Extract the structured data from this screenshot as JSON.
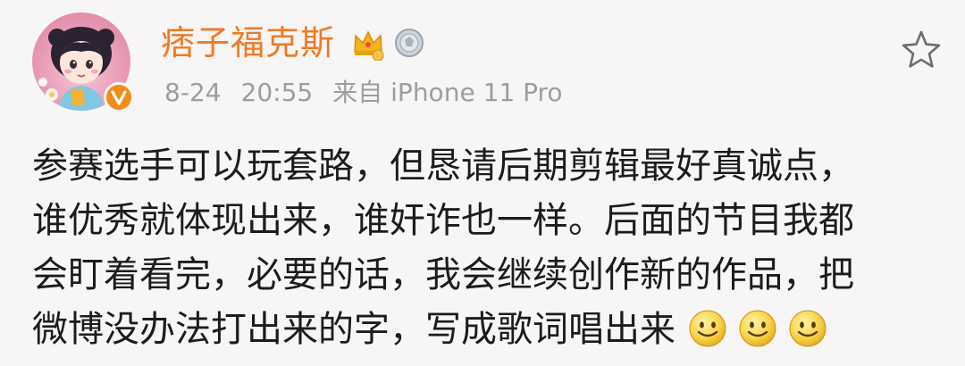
{
  "post": {
    "username": "痞子福克斯",
    "meta": {
      "date": "8-24",
      "time": "20:55",
      "source": "来自 iPhone 11 Pro"
    },
    "text_lines": [
      "参赛选手可以玩套路，但恳请后期剪辑最好真诚点，",
      "谁优秀就体现出来，谁奸诈也一样。后面的节目我都",
      "会盯着看完，必要的话，我会继续创作新的作品，把",
      "微博没办法打出来的字，写成歌词唱出来"
    ],
    "emojis": [
      "smile-emoji",
      "smile-emoji",
      "smile-emoji"
    ]
  },
  "icons": {
    "avatar": "cartoon-girl-avatar",
    "verified": "verified-v-badge",
    "crown": "gold-crown-icon",
    "medal": "silver-medal-icon",
    "favorite": "star-outline-icon"
  },
  "colors": {
    "username": "#ef7a24",
    "meta_text": "#9d9d9d",
    "body_text": "#1c1c1c",
    "verified_badge": "#f28c1a",
    "background": "#f8f5f6"
  }
}
